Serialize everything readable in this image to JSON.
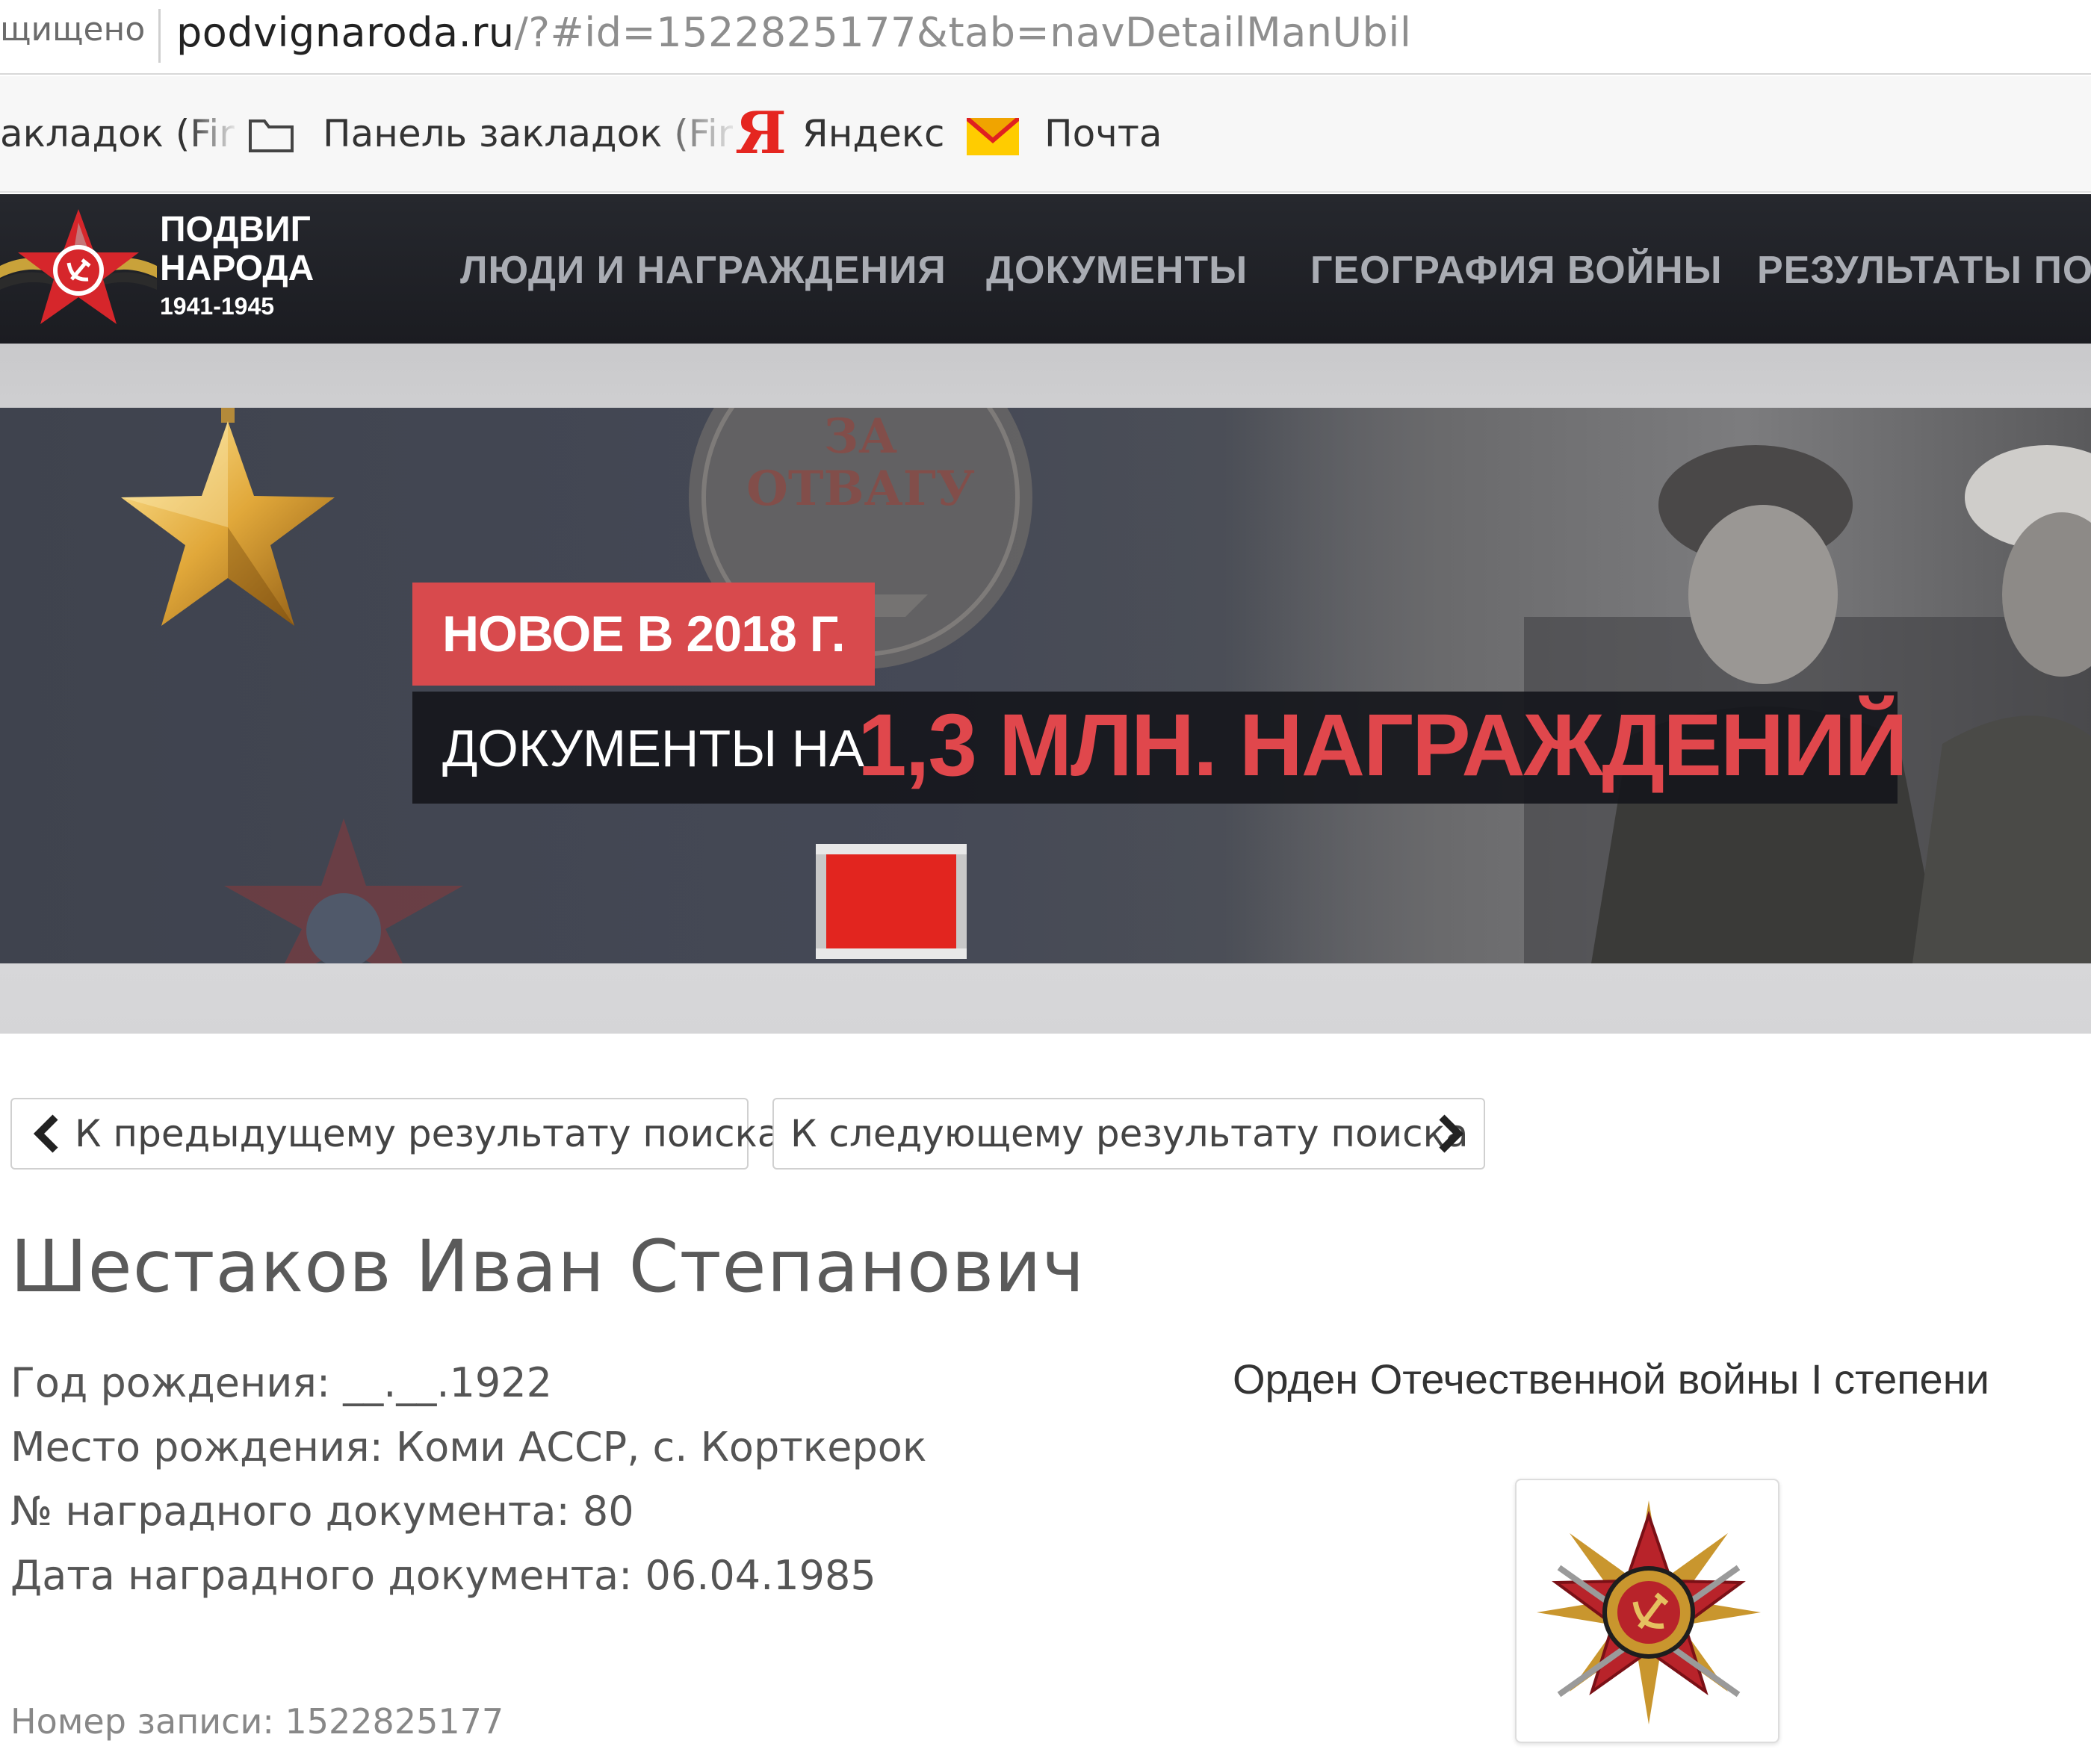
{
  "browser": {
    "secure_label": "щищено",
    "url_domain": "podvignaroda.ru",
    "url_path": "/?#id=1522825177&tab=navDetailManUbil"
  },
  "bookmarks": {
    "items": [
      {
        "label": "акладок (Fir",
        "icon": "none"
      },
      {
        "label": "Панель закладок (Fir",
        "icon": "folder-icon"
      },
      {
        "label": "Яндекс",
        "icon": "yandex-icon"
      },
      {
        "label": "Почта",
        "icon": "mail-icon"
      }
    ]
  },
  "site": {
    "logo": {
      "line1": "ПОДВИГ",
      "line2": "НАРОДА",
      "line3": "1941-1945"
    },
    "nav": [
      {
        "label": "ЛЮДИ И НАГРАЖДЕНИЯ"
      },
      {
        "label": "ДОКУМЕНТЫ"
      },
      {
        "label": "ГЕОГРАФИЯ ВОЙНЫ"
      },
      {
        "label": "РЕЗУЛЬТАТЫ ПОИС"
      }
    ]
  },
  "banner": {
    "new_tag": "НОВОЕ В 2018 Г.",
    "docs_prefix": "ДОКУМЕНТЫ НА",
    "docs_highlight": "1,3 МЛН. НАГРАЖДЕНИЙ",
    "medal_text_line1": "ЗА",
    "medal_text_line2": "ОТВАГУ",
    "accent_color": "#d84a4d"
  },
  "results_nav": {
    "prev_label": "К предыдущему результату поиска",
    "next_label": "К следующему результату поиска"
  },
  "person": {
    "name": "Шестаков Иван Степанович",
    "fields": [
      {
        "text": "Год рождения: __.__.1922"
      },
      {
        "text": "Место рождения: Коми АССР, с. Корткерок"
      },
      {
        "text": "№ наградного документа: 80"
      },
      {
        "text": "Дата наградного документа: 06.04.1985"
      }
    ],
    "record": "Номер записи: 1522825177"
  },
  "award": {
    "title": "Орден Отечественной войны I степени",
    "icon": "order-patriotic-war-icon"
  }
}
